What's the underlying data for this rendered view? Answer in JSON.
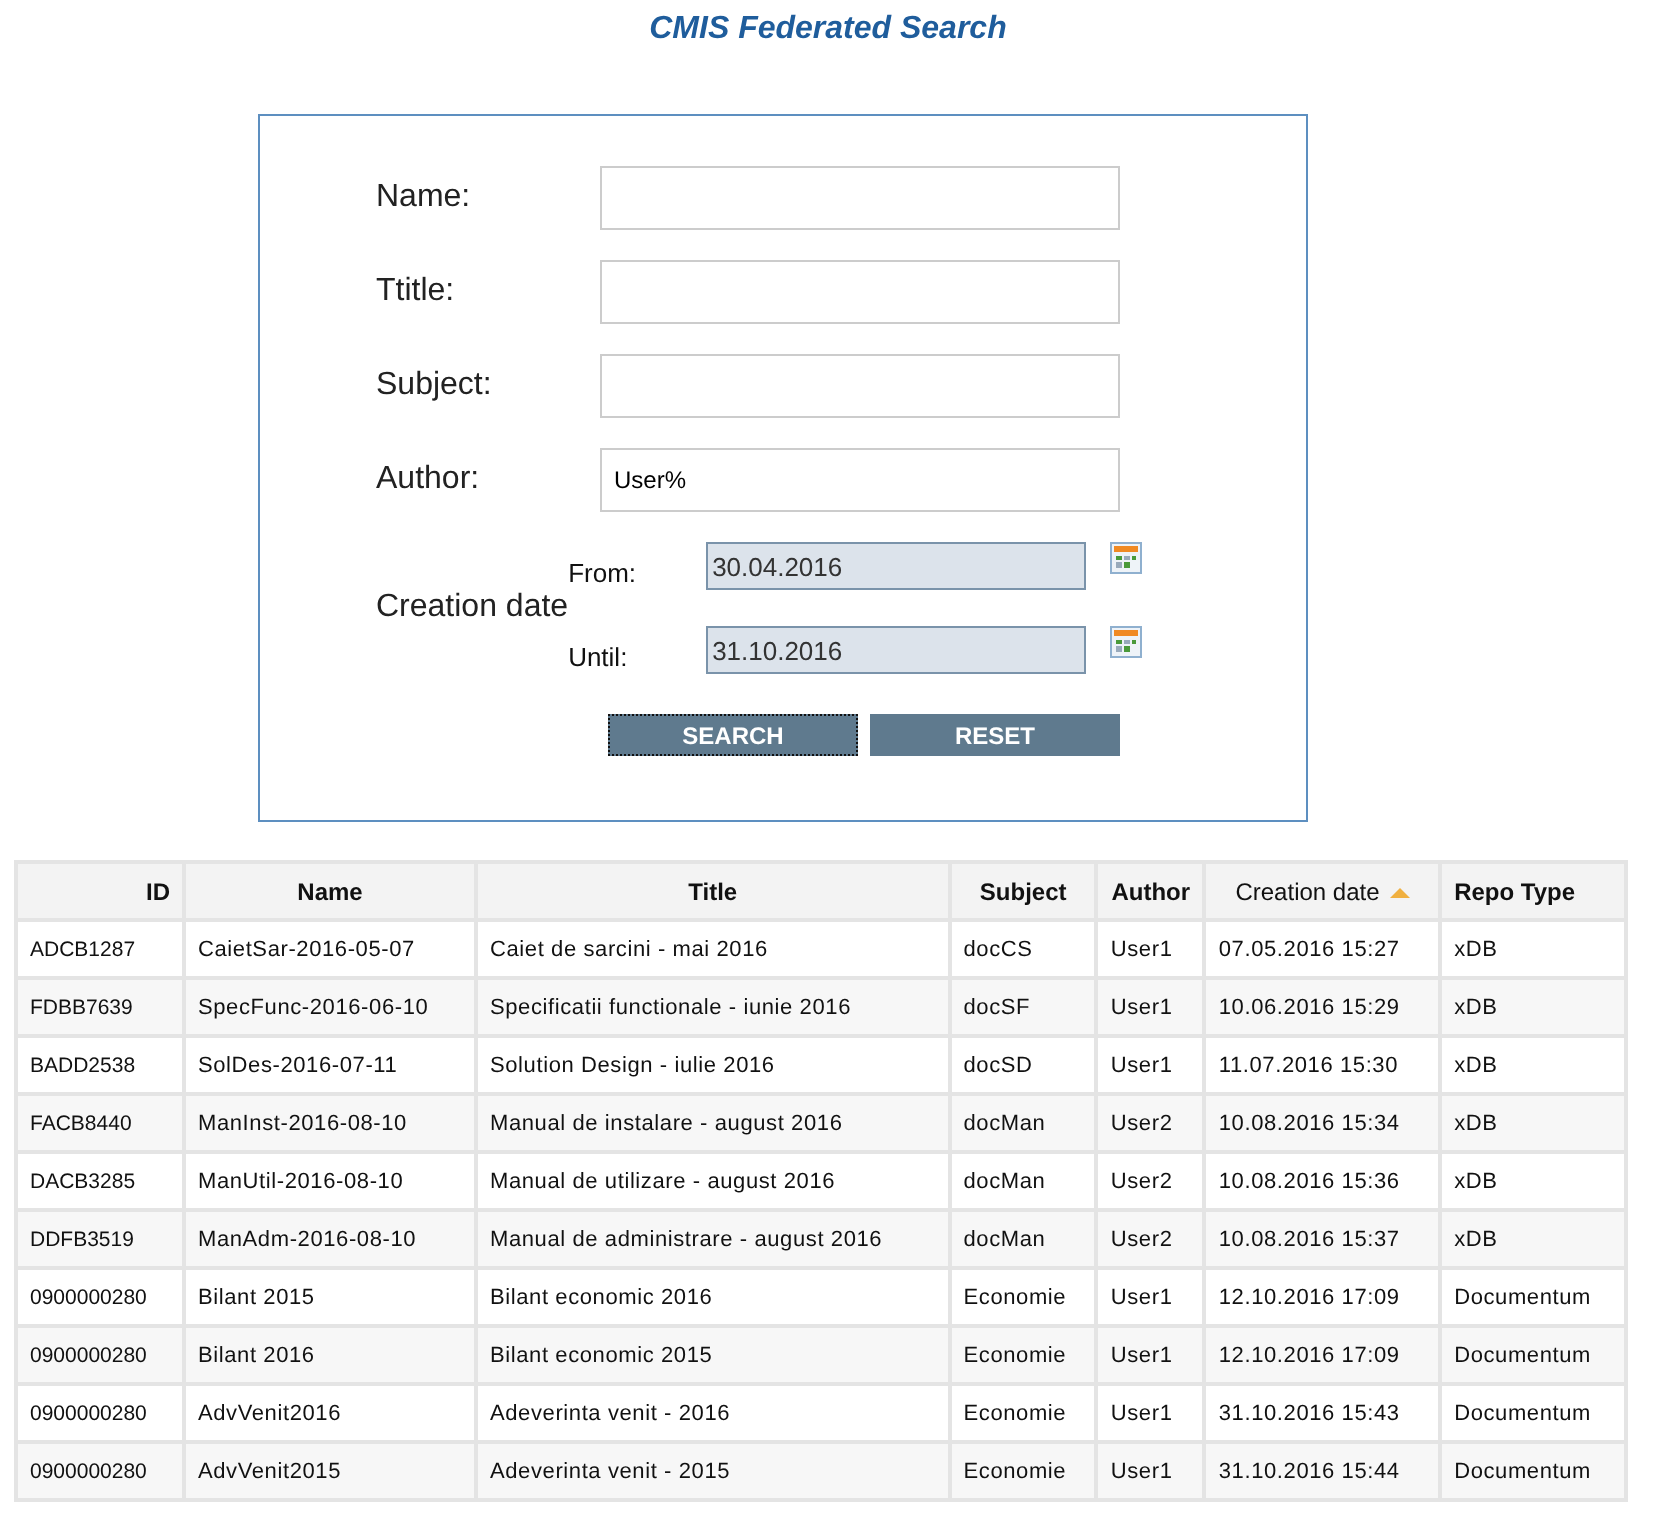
{
  "title": "CMIS Federated Search",
  "form": {
    "fields": [
      {
        "label": "Name:"
      },
      {
        "label": "Ttitle:"
      },
      {
        "label": "Subject:"
      },
      {
        "label": "Author:",
        "value": "User%"
      }
    ],
    "creation_date": {
      "label": "Creation date",
      "from": {
        "label": "From:",
        "value": "30.04.2016"
      },
      "until": {
        "label": "Until:",
        "value": "31.10.2016"
      }
    },
    "buttons": [
      {
        "label": "SEARCH",
        "focused": true
      },
      {
        "label": "RESET",
        "focused": false
      }
    ]
  },
  "table": {
    "columns": [
      {
        "label": "ID",
        "sorted": false
      },
      {
        "label": "Name",
        "sorted": false
      },
      {
        "label": "Title",
        "sorted": false
      },
      {
        "label": "Subject",
        "sorted": false
      },
      {
        "label": "Author",
        "sorted": false
      },
      {
        "label": "Creation date",
        "sorted": true
      },
      {
        "label": "Repo Type",
        "sorted": false
      }
    ],
    "rows": [
      [
        "ADCB1287",
        "CaietSar-2016-05-07",
        "Caiet de sarcini - mai 2016",
        "docCS",
        "User1",
        "07.05.2016 15:27",
        "xDB"
      ],
      [
        "FDBB7639",
        "SpecFunc-2016-06-10",
        "Specificatii functionale - iunie 2016",
        "docSF",
        "User1",
        "10.06.2016 15:29",
        "xDB"
      ],
      [
        "BADD2538",
        "SolDes-2016-07-11",
        "Solution Design - iulie 2016",
        "docSD",
        "User1",
        "11.07.2016 15:30",
        "xDB"
      ],
      [
        "FACB8440",
        "ManInst-2016-08-10",
        "Manual de instalare - august 2016",
        "docMan",
        "User2",
        "10.08.2016 15:34",
        "xDB"
      ],
      [
        "DACB3285",
        "ManUtil-2016-08-10",
        "Manual de utilizare - august 2016",
        "docMan",
        "User2",
        "10.08.2016 15:36",
        "xDB"
      ],
      [
        "DDFB3519",
        "ManAdm-2016-08-10",
        "Manual de administrare - august 2016",
        "docMan",
        "User2",
        "10.08.2016 15:37",
        "xDB"
      ],
      [
        "0900000280",
        "Bilant 2015",
        "Bilant economic 2016",
        "Economie",
        "User1",
        "12.10.2016 17:09",
        "Documentum"
      ],
      [
        "0900000280",
        "Bilant 2016",
        "Bilant economic 2015",
        "Economie",
        "User1",
        "12.10.2016 17:09",
        "Documentum"
      ],
      [
        "0900000280",
        "AdvVenit2016",
        "Adeverinta venit - 2016",
        "Economie",
        "User1",
        "31.10.2016 15:43",
        "Documentum"
      ],
      [
        "0900000280",
        "AdvVenit2015",
        "Adeverinta venit - 2015",
        "Economie",
        "User1",
        "31.10.2016 15:44",
        "Documentum"
      ]
    ]
  }
}
